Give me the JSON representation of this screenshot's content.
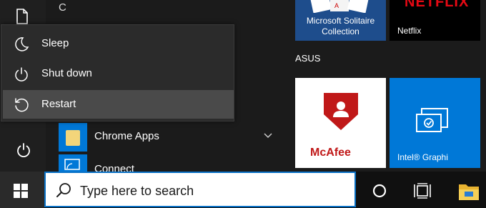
{
  "start": {
    "list_letter": "C",
    "apps": [
      {
        "label": "Chrome Apps"
      },
      {
        "label": "Connect"
      }
    ]
  },
  "power_menu": {
    "items": [
      {
        "label": "Sleep",
        "icon": "moon-icon"
      },
      {
        "label": "Shut down",
        "icon": "power-icon"
      },
      {
        "label": "Restart",
        "icon": "restart-icon",
        "hovered": true
      }
    ]
  },
  "tiles": {
    "solitaire": {
      "label": "Microsoft Solitaire Collection"
    },
    "netflix": {
      "logo": "NETFLIX",
      "label": "Netflix"
    },
    "group_name": "ASUS",
    "mcafee": {
      "logo": "McAfee"
    },
    "intel": {
      "label": "Intel® Graphi"
    }
  },
  "taskbar": {
    "search_placeholder": "Type here to search"
  },
  "colors": {
    "accent": "#0078d7",
    "menu_bg": "#2b2b2b",
    "menu_hover": "#4a4a4a",
    "mcafee_red": "#c01818",
    "netflix_red": "#e50914"
  }
}
